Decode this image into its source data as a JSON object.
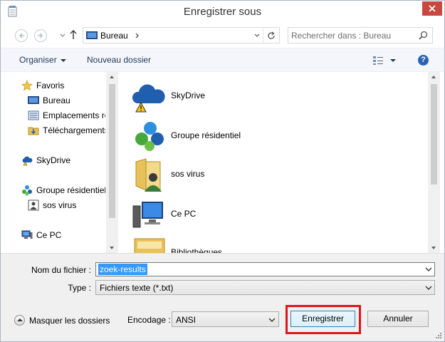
{
  "window": {
    "title": "Enregistrer sous",
    "close_icon": "close-icon"
  },
  "navigation": {
    "back_icon": "back-arrow-icon",
    "forward_icon": "forward-arrow-icon",
    "up_icon": "up-arrow-icon",
    "address": {
      "crumb": "Bureau",
      "icon": "desktop-icon"
    },
    "refresh_icon": "refresh-icon",
    "search": {
      "placeholder": "Rechercher dans : Bureau",
      "value": "",
      "icon": "search-icon"
    }
  },
  "toolbar": {
    "organize_label": "Organiser",
    "new_folder_label": "Nouveau dossier",
    "view_icon": "view-options-icon",
    "help_icon": "help-icon",
    "help_glyph": "?"
  },
  "nav_pane": {
    "items": [
      {
        "label": "Favoris",
        "icon": "star-icon"
      },
      {
        "label": "Bureau",
        "icon": "desktop-icon"
      },
      {
        "label": "Emplacements ré",
        "icon": "recent-places-icon"
      },
      {
        "label": "Téléchargements",
        "icon": "downloads-icon"
      },
      {
        "label": "SkyDrive",
        "icon": "skydrive-icon"
      },
      {
        "label": "Groupe résidentiel",
        "icon": "homegroup-icon"
      },
      {
        "label": "sos virus",
        "icon": "user-icon"
      },
      {
        "label": "Ce PC",
        "icon": "computer-icon"
      }
    ]
  },
  "content": {
    "items": [
      {
        "label": "SkyDrive",
        "icon": "skydrive-icon"
      },
      {
        "label": "Groupe résidentiel",
        "icon": "homegroup-icon"
      },
      {
        "label": "sos virus",
        "icon": "user-folder-icon"
      },
      {
        "label": "Ce PC",
        "icon": "computer-icon"
      },
      {
        "label": "Bibliothèques",
        "icon": "libraries-icon"
      }
    ]
  },
  "form": {
    "filename_label": "Nom du fichier :",
    "filename_value": "zoek-results",
    "type_label": "Type :",
    "type_value": "Fichiers texte (*.txt)"
  },
  "footer": {
    "hide_folders_label": "Masquer les dossiers",
    "encoding_label": "Encodage :",
    "encoding_value": "ANSI",
    "save_label": "Enregistrer",
    "cancel_label": "Annuler",
    "highlight_color": "#e0161b"
  }
}
